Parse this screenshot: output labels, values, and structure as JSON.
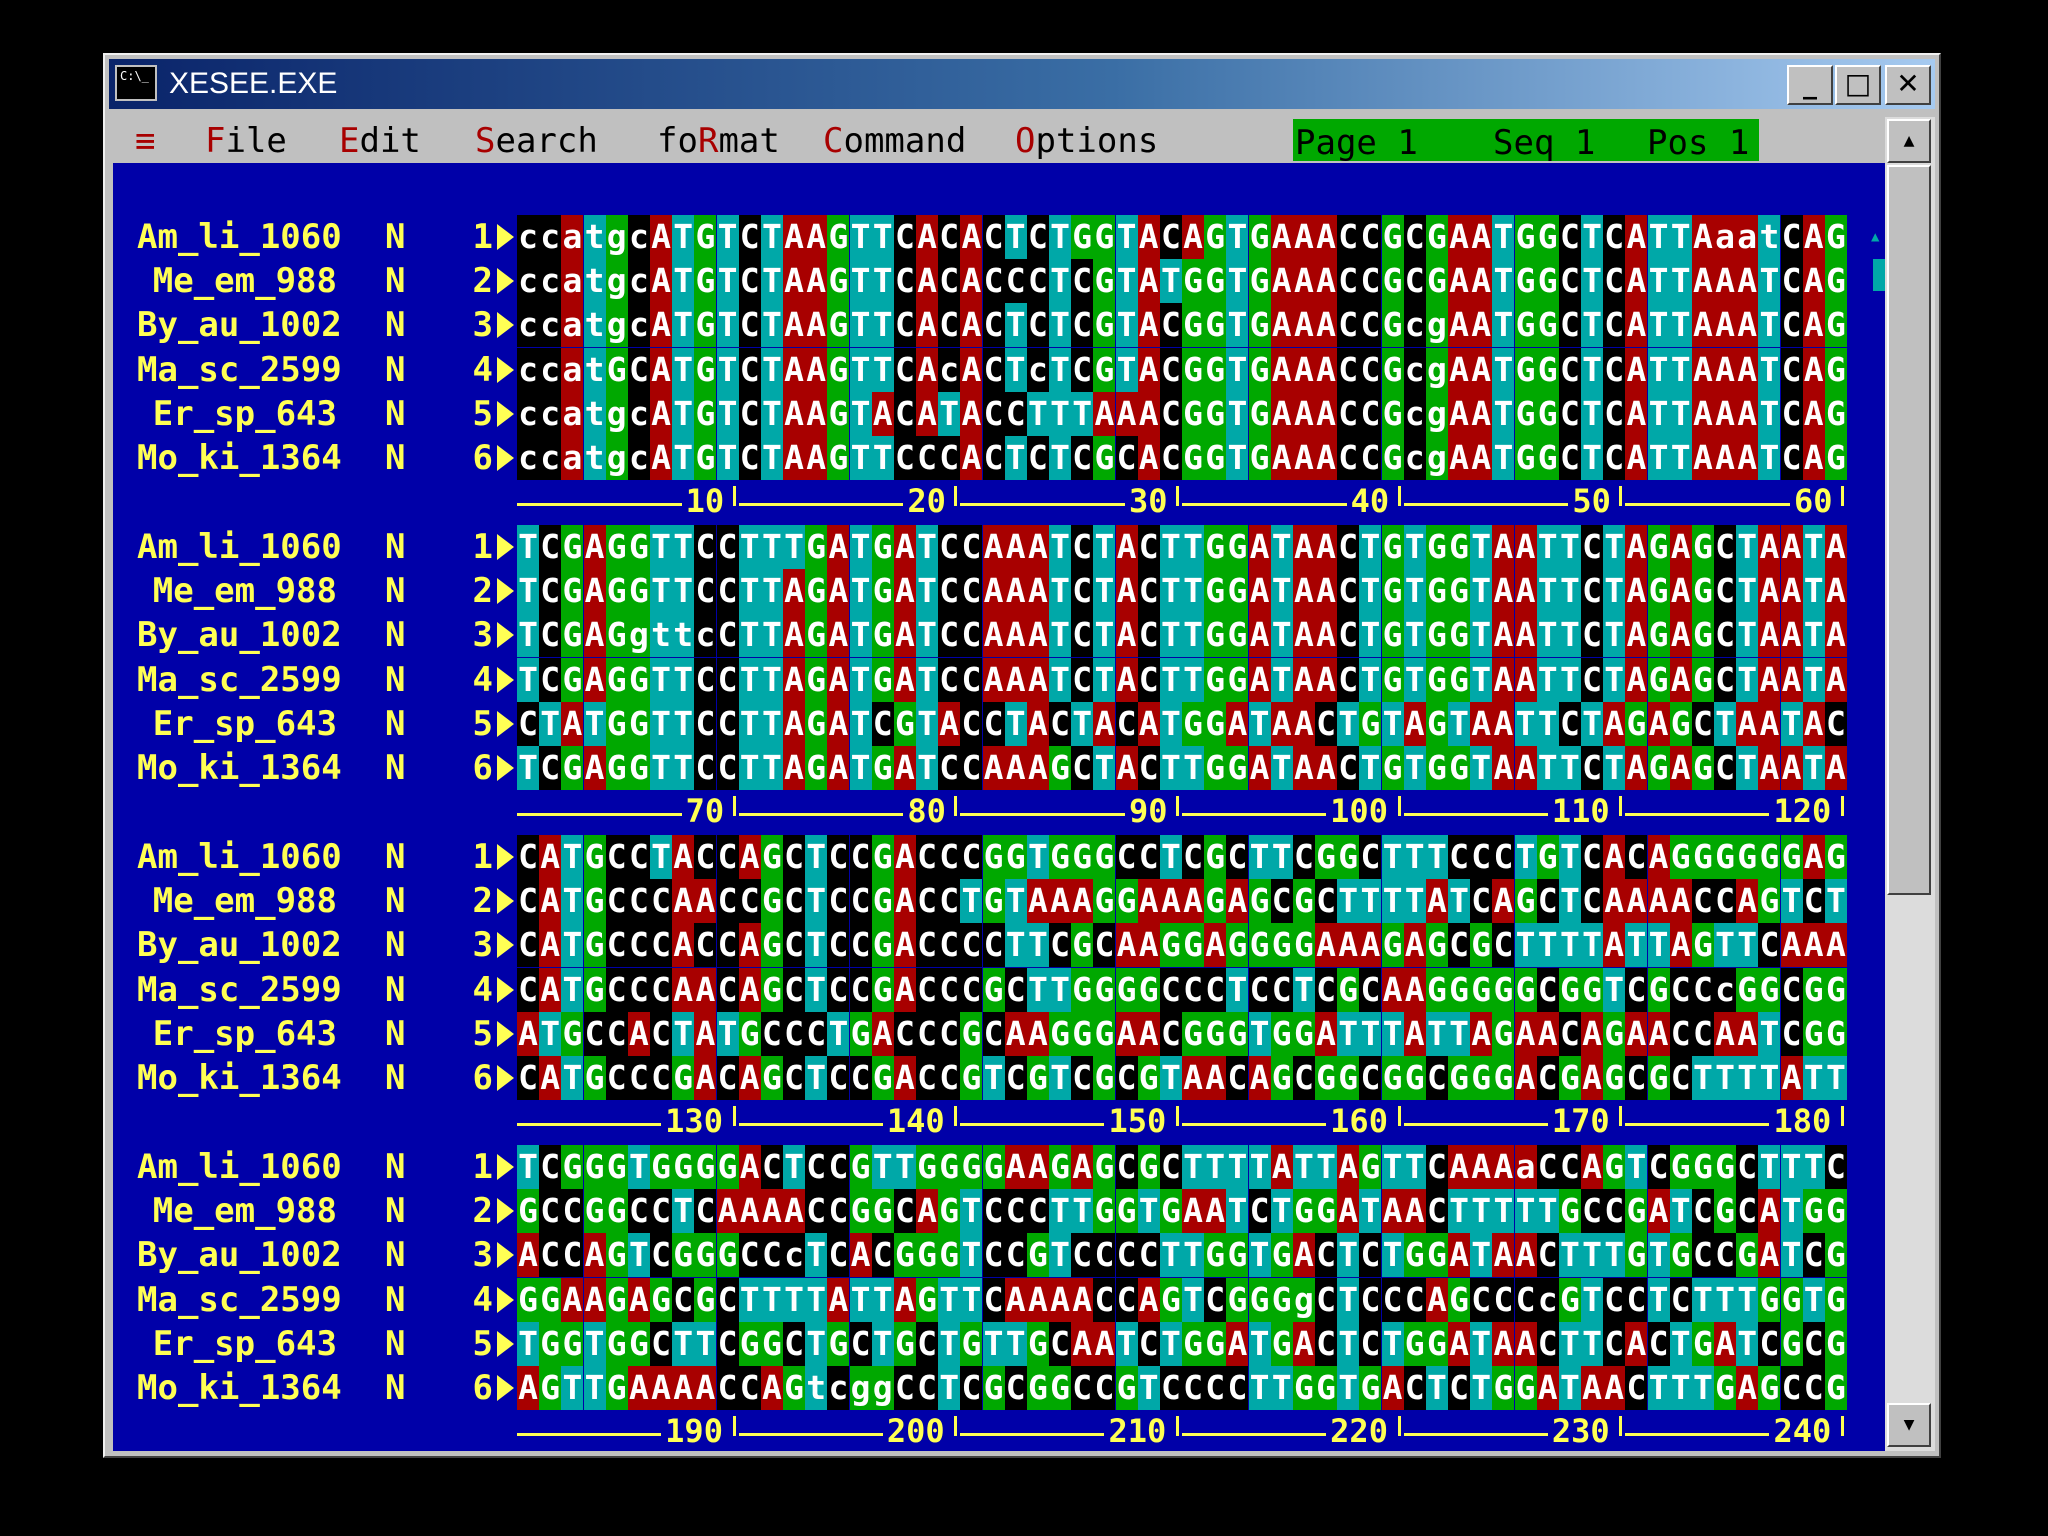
{
  "window": {
    "title": "XESEE.EXE",
    "minimize": "_",
    "maximize": "□",
    "close": "✕"
  },
  "menu": {
    "system": "≡",
    "items": [
      {
        "hot": "F",
        "rest": "ile"
      },
      {
        "hot": "E",
        "rest": "dit"
      },
      {
        "hot": "S",
        "rest": "earch"
      },
      {
        "pre": "fo",
        "hot": "R",
        "rest": "mat"
      },
      {
        "hot": "C",
        "rest": "ommand"
      },
      {
        "hot": "O",
        "rest": "ptions"
      }
    ]
  },
  "status": {
    "page": "Page 1",
    "seq": "Seq 1",
    "pos": "Pos 1"
  },
  "scroll": {
    "up": "▲",
    "down": "▼"
  },
  "colors": {
    "A": "#a80000",
    "C": "#000000",
    "G": "#00a800",
    "T": "#00a8a8",
    "background": "#0000a8",
    "label": "#ffff54"
  },
  "sequences": [
    {
      "name": "Am_li_1060",
      "flag": "N",
      "num": "1"
    },
    {
      "name": "Me_em_988",
      "flag": "N",
      "num": "2"
    },
    {
      "name": "By_au_1002",
      "flag": "N",
      "num": "3"
    },
    {
      "name": "Ma_sc_2599",
      "flag": "N",
      "num": "4"
    },
    {
      "name": "Er_sp_643",
      "flag": "N",
      "num": "5"
    },
    {
      "name": "Mo_ki_1364",
      "flag": "N",
      "num": "6"
    }
  ],
  "blocks": [
    {
      "rows": [
        "ccatgcATGTCTAAGTTCACACTCTGGTACAGTGAAACCGCGAATGGCTCATTAaatCAG",
        "ccatgcATGTCTAAGTTCACACCCTCGTATGGTGAAACCGCGAATGGCTCATTAAATCAG",
        "ccatgcATGTCTAAGTTCACACTCTCGTACGGTGAAACCGcgAATGGCTCATTAAATCAG",
        "ccatGCATGTCTAAGTTCAcACTcTCGTACGGTGAAACCGcgAATGGCTCATTAAATCAG",
        "ccatgcATGTCTAAGTACATACCTTTAAACGGTGAAACCGcgAATGGCTCATTAAATCAG",
        "ccatgcATGTCTAAGTTCCCACTCTCGCACGGTGAAACCGcgAATGGCTCATTAAATCAG"
      ],
      "ruler": [
        "10",
        "20",
        "30",
        "40",
        "50",
        "60"
      ]
    },
    {
      "rows": [
        "TCGAGGTTCCTTTGATGATCCAAATCTACTTGGATAACTGTGGTAATTCTAGAGCTAATA",
        "TCGAGGTTCCTTAGATGATCCAAATCTACTTGGATAACTGTGGTAATTCTAGAGCTAATA",
        "TCGAGgttcCTTAGATGATCCAAATCTACTTGGATAACTGTGGTAATTCTAGAGCTAATA",
        "TCGAGGTTCCTTAGATGATCCAAATCTACTTGGATAACTGTGGTAATTCTAGAGCTAATA",
        "CTATGGTTCCTTAGATCGTACCTACTACATGGATAACTGTAGTAATTCTAGAGCTAATAC",
        "TCGAGGTTCCTTAGATGATCCAAAGCTACTTGGATAACTGTGGTAATTCTAGAGCTAATA"
      ],
      "ruler": [
        "70",
        "80",
        "90",
        "100",
        "110",
        "120"
      ]
    },
    {
      "rows": [
        "CATGCCTACCAGCTCCGACCCGGTGGGCCTCGCTTCGGCTTTCCCTGTCACAGGGGGGAG",
        "CATGCCCAACCGCTCCGACCTGTAAAGGAAAGAGCGCTTTTATCAGCTCAAAACCAGTCT",
        "CATGCCCACCAGCTCCGACCCCTTCGCAAGGAGGGGAAAGAGCGCTTTTATTAGTTCAAA",
        "CATGCCCAACAGCTCCGACCCGCTTGGGGCCCTCCTCGCAAGGGGGCGGTCGCCcGGCGG",
        "ATGCCACTATGCCCTGACCCGCAAGGGAACGGGTGGATTTATTAGAACAGAACCAATCGG",
        "CATGCCCGACAGCTCCGACCGTCGTCGCGTAACAGCGGCGGCGGGACGAGCGCTTTTATT"
      ],
      "ruler": [
        "130",
        "140",
        "150",
        "160",
        "170",
        "180"
      ]
    },
    {
      "rows": [
        "TCGGGTGGGGACTCCGTTGGGGAAGAGCGCTTTTATTAGTTCAAAaCCAGTCGGGCTTTC",
        "GCCGGCCTCAAAACCGGCAGTCCCTTGGTGAATCTGGATAACTTTTTGCCGATCGCATGG",
        "ACCAGTCGGGCCcTCACGGGTCCGTCCCCTTGGTGACTCTGGATAACTTTGTGCCGATCG",
        "GGAAGAGCGCTTTTATTAGTTCAAAACCAGTCGGGgCTCCCAGCCCcGTCCTCTTTGGTG",
        "TGGTGGCTTCGGCTGCTGCTGTTGCAATCTGGATGACTCTGGATAACTTCACTGATCGCG",
        "AGTTGAAAACCAGtcggCCTCGCGGCCGTCCCCTTGGTGACTCTGGATAACTTTGAGCCG"
      ],
      "ruler": [
        "190",
        "200",
        "210",
        "220",
        "230",
        "240"
      ]
    }
  ]
}
